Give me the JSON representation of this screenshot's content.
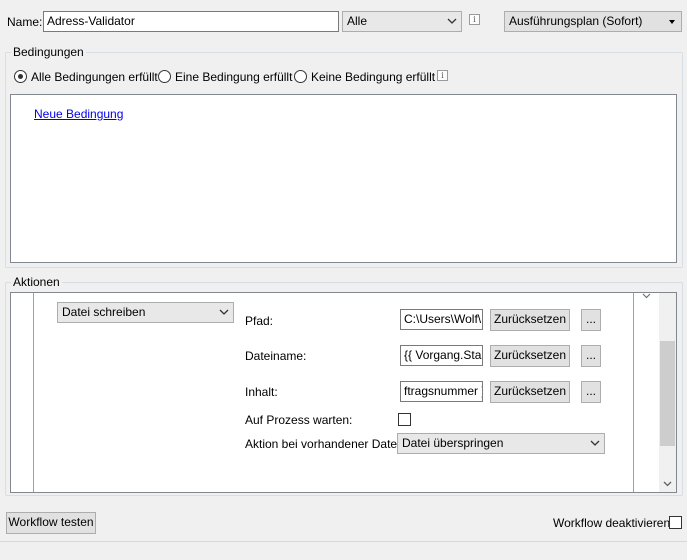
{
  "header": {
    "name_label": "Name:",
    "name_value": "Adress-Validator",
    "scope_value": "Alle",
    "info_glyph": "i",
    "schedule_value": "Ausführungsplan (Sofort)"
  },
  "conditions": {
    "group_title": "Bedingungen",
    "options": [
      {
        "label": "Alle Bedingungen erfüllt",
        "checked": true
      },
      {
        "label": "Eine Bedingung erfüllt",
        "checked": false
      },
      {
        "label": "Keine Bedingung erfüllt",
        "checked": false
      }
    ],
    "new_condition_link": "Neue Bedingung"
  },
  "actions": {
    "group_title": "Aktionen",
    "action_type": "Datei schreiben",
    "path_label": "Pfad:",
    "path_value": "C:\\Users\\Wolf\\",
    "filename_label": "Dateiname:",
    "filename_value": "{{ Vorgang.Stam",
    "content_label": "Inhalt:",
    "content_value": "ftragsnummer }}",
    "reset_label": "Zurücksetzen",
    "browse_label": "...",
    "wait_label": "Auf Prozess warten:",
    "wait_checked": false,
    "existing_file_label": "Aktion bei vorhandener Datei:",
    "existing_file_value": "Datei überspringen"
  },
  "footer": {
    "test_button": "Workflow testen",
    "deactivate_label": "Workflow deaktivieren",
    "deactivate_checked": false
  },
  "icons": {
    "chevron": "chevron-down-icon",
    "scroll_up": "scroll-up-arrow-icon",
    "scroll_down": "scroll-down-arrow-icon",
    "info": "info-icon"
  }
}
